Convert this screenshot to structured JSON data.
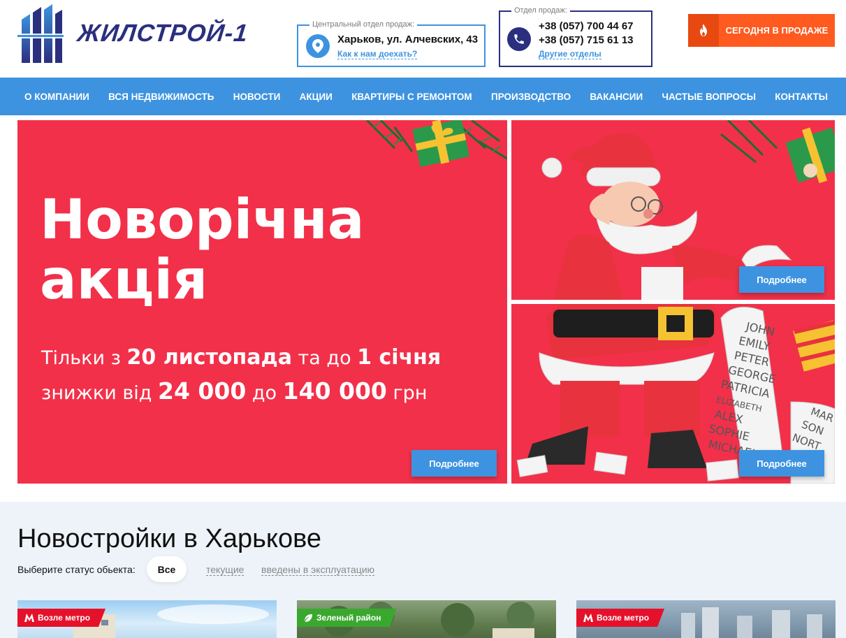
{
  "header": {
    "logo_text": "ЖИЛСТРОЙ-1",
    "address_box": {
      "legend": "Центральный отдел продаж:",
      "address": "Харьков, ул. Алчевских, 43",
      "link": "Как к нам доехать?"
    },
    "phone_box": {
      "legend": "Отдел продаж:",
      "phone1": "+38 (057) 700 44 67",
      "phone2": "+38 (057) 715 61 13",
      "link": "Другие отделы"
    },
    "sale_button": "СЕГОДНЯ В ПРОДАЖЕ"
  },
  "nav": {
    "items": [
      "О КОМПАНИИ",
      "ВСЯ НЕДВИЖИМОСТЬ",
      "НОВОСТИ",
      "АКЦИИ",
      "КВАРТИРЫ С РЕМОНТОМ",
      "ПРОИЗВОДСТВО",
      "ВАКАНСИИ",
      "ЧАСТЫЕ ВОПРОСЫ",
      "КОНТАКТЫ"
    ]
  },
  "banner_main": {
    "title_line1": "Новорічна",
    "title_line2": "акція",
    "line1_a": "Тільки з ",
    "line1_b": "20 листопада",
    "line1_c": " та до ",
    "line1_d": "1 січня",
    "line2_a": "знижки від ",
    "line2_b": "24 000",
    "line2_c": " до ",
    "line2_d": "140 000",
    "line2_e": " грн",
    "button": "Подробнее"
  },
  "banner_side_top": {
    "button": "Подробнее"
  },
  "banner_side_bottom": {
    "button": "Подробнее",
    "list_names": [
      "JOHN",
      "EMILY",
      "PETER",
      "GEORGE",
      "PATRICIA",
      "ELIZABETH",
      "ALEX",
      "SOPHIE",
      "MICHAEL"
    ],
    "list_names_right": [
      "MAR",
      "SON",
      "NORT"
    ]
  },
  "section": {
    "title": "Новостройки в Харькове",
    "filter_label": "Выберите статус обьекта:",
    "filters": [
      "Все",
      "текущие",
      "введены в эксплуатацию"
    ]
  },
  "cards": [
    {
      "tag": "Возле метро",
      "tag_type": "metro"
    },
    {
      "tag": "Зеленый район",
      "tag_type": "green"
    },
    {
      "tag": "Возле метро",
      "tag_type": "metro"
    }
  ],
  "colors": {
    "brand_navy": "#2a2f7e",
    "brand_blue": "#3d93e0",
    "promo_red": "#f2304a",
    "sale_orange": "#ff5a1f",
    "metro_red": "#e5112b",
    "green_tag": "#3aa82f"
  },
  "icons": {
    "address": "map-pin-icon",
    "phone": "phone-icon",
    "sale": "fire-icon",
    "metro": "metro-m-icon",
    "green": "leaf-icon"
  }
}
